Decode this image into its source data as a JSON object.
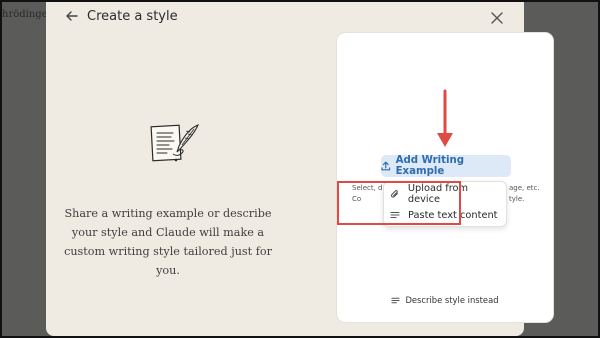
{
  "background": {
    "partial_text": "hrödinger"
  },
  "modal": {
    "title": "Create a style",
    "intro_text": "Share a writing example or describe your style and Claude will make a custom writing style tailored just for you."
  },
  "card": {
    "add_button_label": "Add Writing Example",
    "helper_left_1": "Select, d",
    "helper_left_2": "Co",
    "helper_right_1": "age, etc.",
    "helper_right_2": "tyle.",
    "dropdown": [
      {
        "label": "Upload from device",
        "icon": "paperclip-icon"
      },
      {
        "label": "Paste text content",
        "icon": "lines-icon"
      }
    ],
    "describe_link_label": "Describe style instead"
  },
  "colors": {
    "overlay": "#5b5b5a",
    "modal_bg": "#efebe3",
    "accent_blue": "#2f6db0",
    "button_bg": "#dde9f6",
    "annotation_red": "#e04a45"
  }
}
